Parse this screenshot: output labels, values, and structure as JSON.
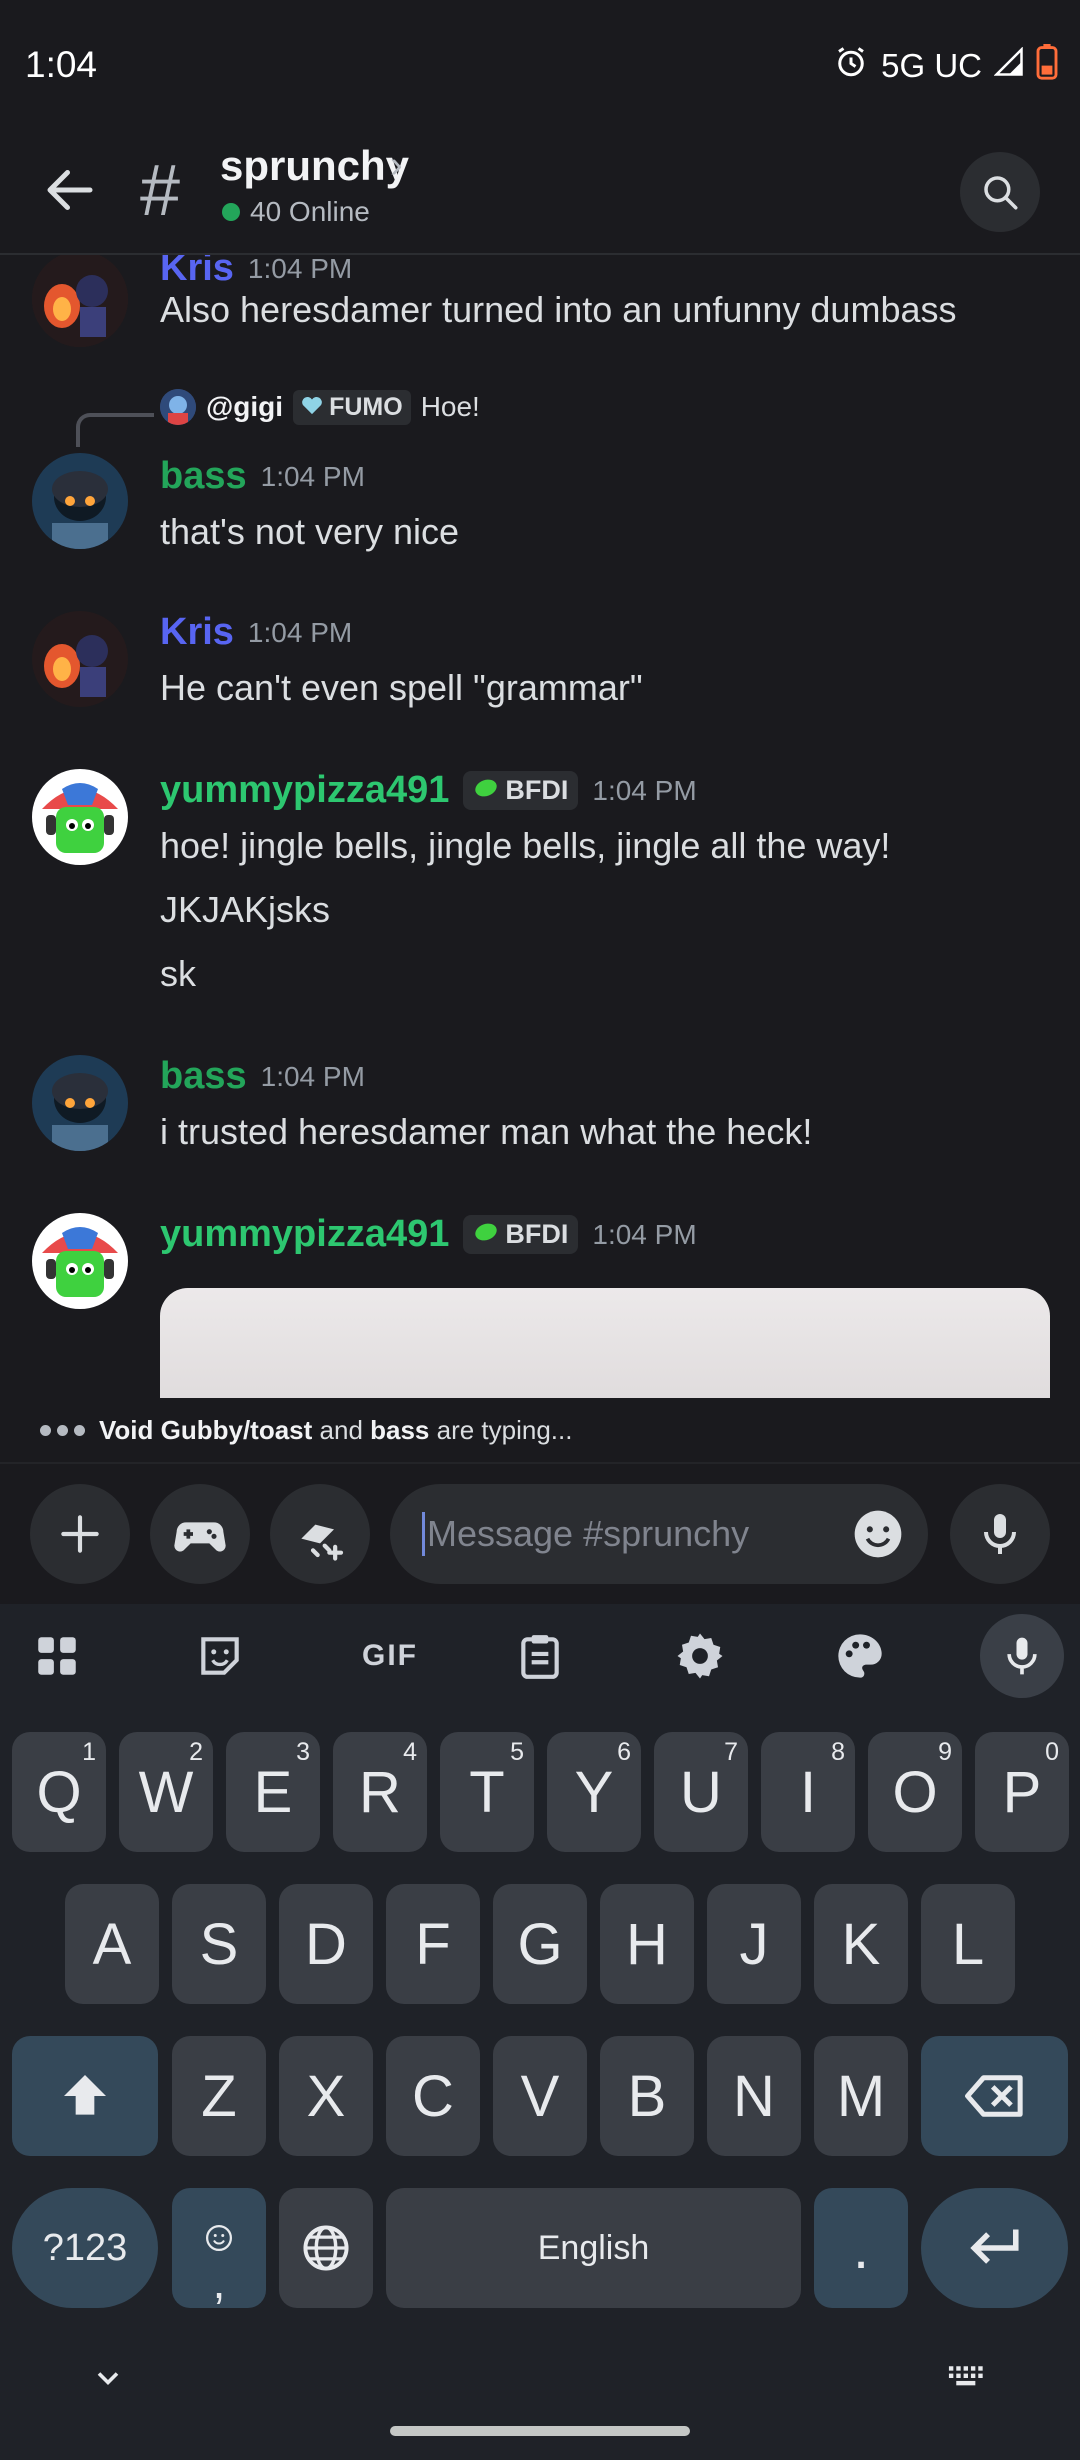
{
  "status_bar": {
    "time": "1:04",
    "network": "5G UC"
  },
  "header": {
    "channel_name": "sprunchy",
    "online": "40 Online"
  },
  "composer": {
    "placeholder": "Message #sprunchy"
  },
  "typing": {
    "user1": "Void Gubby/toast",
    "and": " and ",
    "user2": "bass",
    "suffix": " are typing..."
  },
  "messages": [
    {
      "author": "Kris",
      "color": "#5865f2",
      "time": "1:04 PM",
      "lines": [
        "Also heresdamer turned into an unfunny dumbass"
      ]
    },
    {
      "reply": {
        "name": "@gigi",
        "tag": "FUMO",
        "text": "Hoe!"
      },
      "author": "bass",
      "color": "#23a55a",
      "time": "1:04 PM",
      "lines": [
        "that's not very nice"
      ]
    },
    {
      "author": "Kris",
      "color": "#5865f2",
      "time": "1:04 PM",
      "lines": [
        "He can't even spell \"grammar\""
      ]
    },
    {
      "author": "yummypizza491",
      "color": "#2dc770",
      "tag": "BFDI",
      "time": "1:04 PM",
      "lines": [
        "hoe! jingle bells, jingle bells, jingle all the way!",
        "JKJAKjsks",
        "sk"
      ]
    },
    {
      "author": "bass",
      "color": "#23a55a",
      "time": "1:04 PM",
      "lines": [
        "i trusted heresdamer man what the heck!"
      ]
    },
    {
      "author": "yummypizza491",
      "color": "#2dc770",
      "tag": "BFDI",
      "time": "1:04 PM",
      "lines": []
    }
  ],
  "keyboard": {
    "toolbar": [
      "apps",
      "sticker",
      "GIF",
      "clipboard",
      "settings",
      "palette",
      "mic"
    ],
    "row1": [
      "Q",
      "W",
      "E",
      "R",
      "T",
      "Y",
      "U",
      "I",
      "O",
      "P"
    ],
    "row1_hints": [
      "1",
      "2",
      "3",
      "4",
      "5",
      "6",
      "7",
      "8",
      "9",
      "0"
    ],
    "row2": [
      "A",
      "S",
      "D",
      "F",
      "G",
      "H",
      "J",
      "K",
      "L"
    ],
    "row3": [
      "Z",
      "X",
      "C",
      "V",
      "B",
      "N",
      "M"
    ],
    "symbols": "?123",
    "comma": ",",
    "space": "English",
    "period": "."
  },
  "colors": {
    "accent_blurple": "#5865f2",
    "green_name": "#23a55a",
    "online_dot": "#23a55a"
  }
}
